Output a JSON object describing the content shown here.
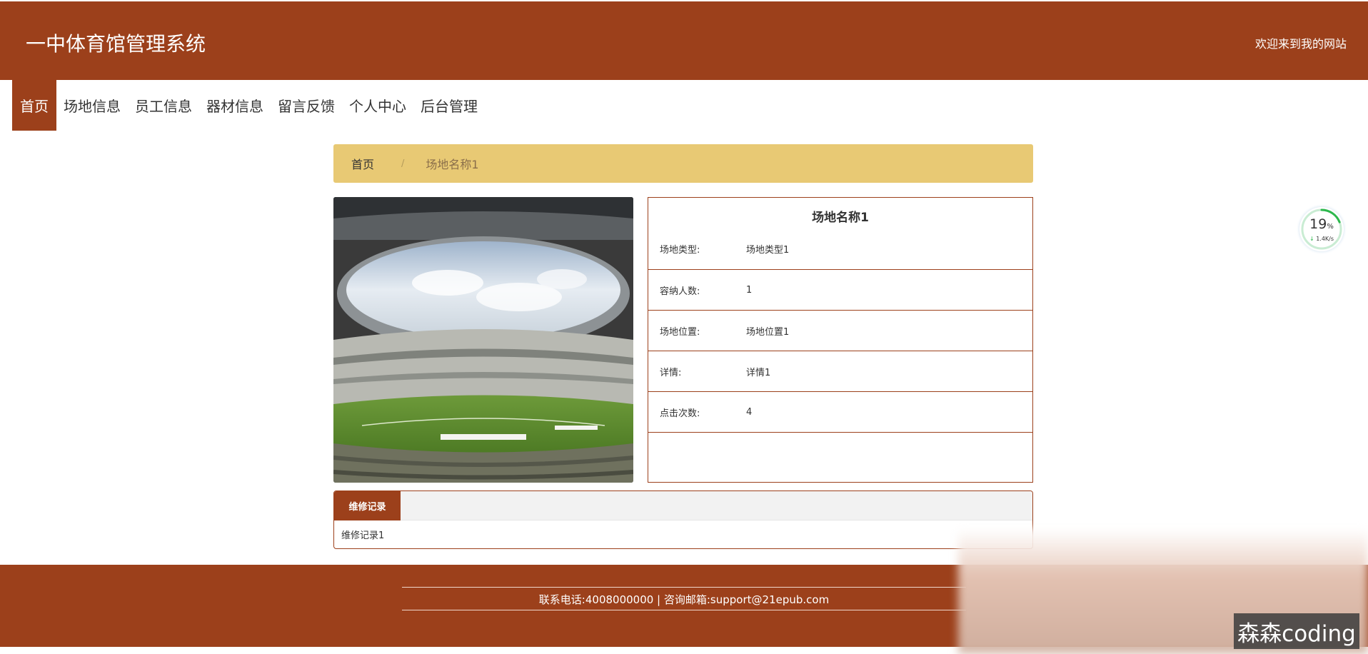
{
  "header": {
    "site_title": "一中体育馆管理系统",
    "welcome": "欢迎来到我的网站"
  },
  "nav": {
    "items": [
      "首页",
      "场地信息",
      "员工信息",
      "器材信息",
      "留言反馈",
      "个人中心",
      "后台管理"
    ],
    "active": "首页"
  },
  "breadcrumb": {
    "home": "首页",
    "separator": "/",
    "current": "场地名称1"
  },
  "venue": {
    "name": "场地名称1",
    "fields": [
      {
        "label": "场地类型:",
        "value": "场地类型1"
      },
      {
        "label": "容纳人数:",
        "value": "1"
      },
      {
        "label": "场地位置:",
        "value": "场地位置1"
      },
      {
        "label": "详情:",
        "value": "详情1"
      },
      {
        "label": "点击次数:",
        "value": "4"
      }
    ]
  },
  "tabs": {
    "active_label": "维修记录",
    "content": "维修记录1"
  },
  "footer": {
    "contact": "联系电话:4008000000 | 咨询邮箱:support@21epub.com"
  },
  "speed_widget": {
    "percent": "19",
    "percent_unit": "%",
    "rate": "1.4K/s"
  },
  "watermark": "森森coding",
  "colors": {
    "brand": "#9c401b",
    "breadcrumb_bg": "#e8c974"
  }
}
